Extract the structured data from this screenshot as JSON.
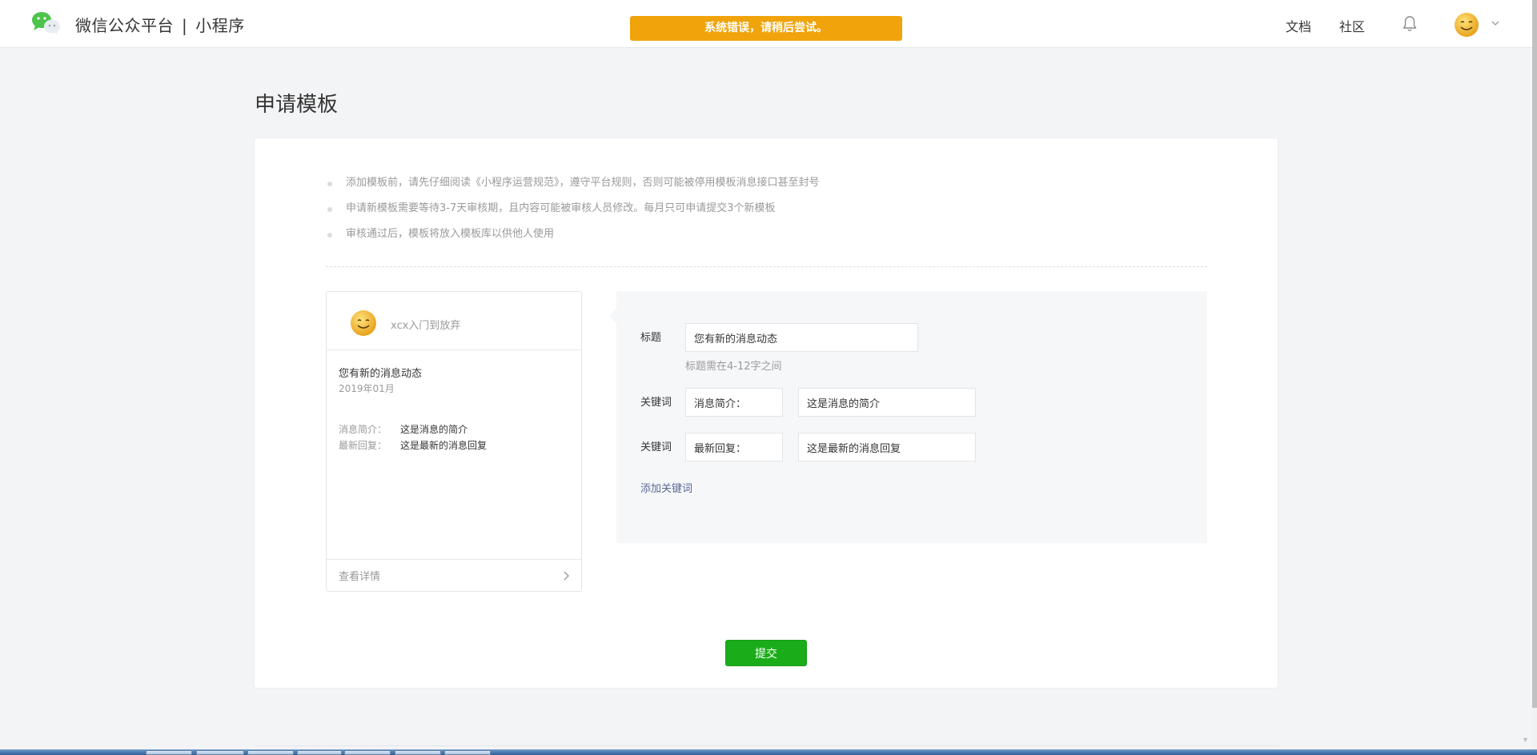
{
  "header": {
    "brand_name": "微信公众平台",
    "brand_separator": "|",
    "product_name": "小程序",
    "error_message": "系统错误，请稍后尝试。",
    "nav": {
      "docs": "文档",
      "community": "社区"
    }
  },
  "page": {
    "title": "申请模板"
  },
  "tips": [
    "添加模板前，请先仔细阅读《小程序运营规范》，遵守平台规则，否则可能被停用模板消息接口甚至封号",
    "申请新模板需要等待3-7天审核期，且内容可能被审核人员修改。每月只可申请提交3个新模板",
    "审核通过后，模板将放入模板库以供他人使用"
  ],
  "preview": {
    "account_name": "xcx入门到放弃",
    "message_title": "您有新的消息动态",
    "date": "2019年01月",
    "fields": [
      {
        "key": "消息简介：",
        "value": "这是消息的简介"
      },
      {
        "key": "最新回复：",
        "value": "这是最新的消息回复"
      }
    ],
    "view_details": "查看详情"
  },
  "form": {
    "title_label": "标题",
    "title_value": "您有新的消息动态",
    "title_hint": "标题需在4-12字之间",
    "keyword_label": "关键词",
    "keywords": [
      {
        "name": "消息简介：",
        "value": "这是消息的简介"
      },
      {
        "name": "最新回复：",
        "value": "这是最新的消息回复"
      }
    ],
    "add_keyword": "添加关键词",
    "submit": "提交"
  },
  "colors": {
    "accent_green": "#1aad19",
    "error_banner": "#f0a30a",
    "link_blue": "#576b95"
  }
}
